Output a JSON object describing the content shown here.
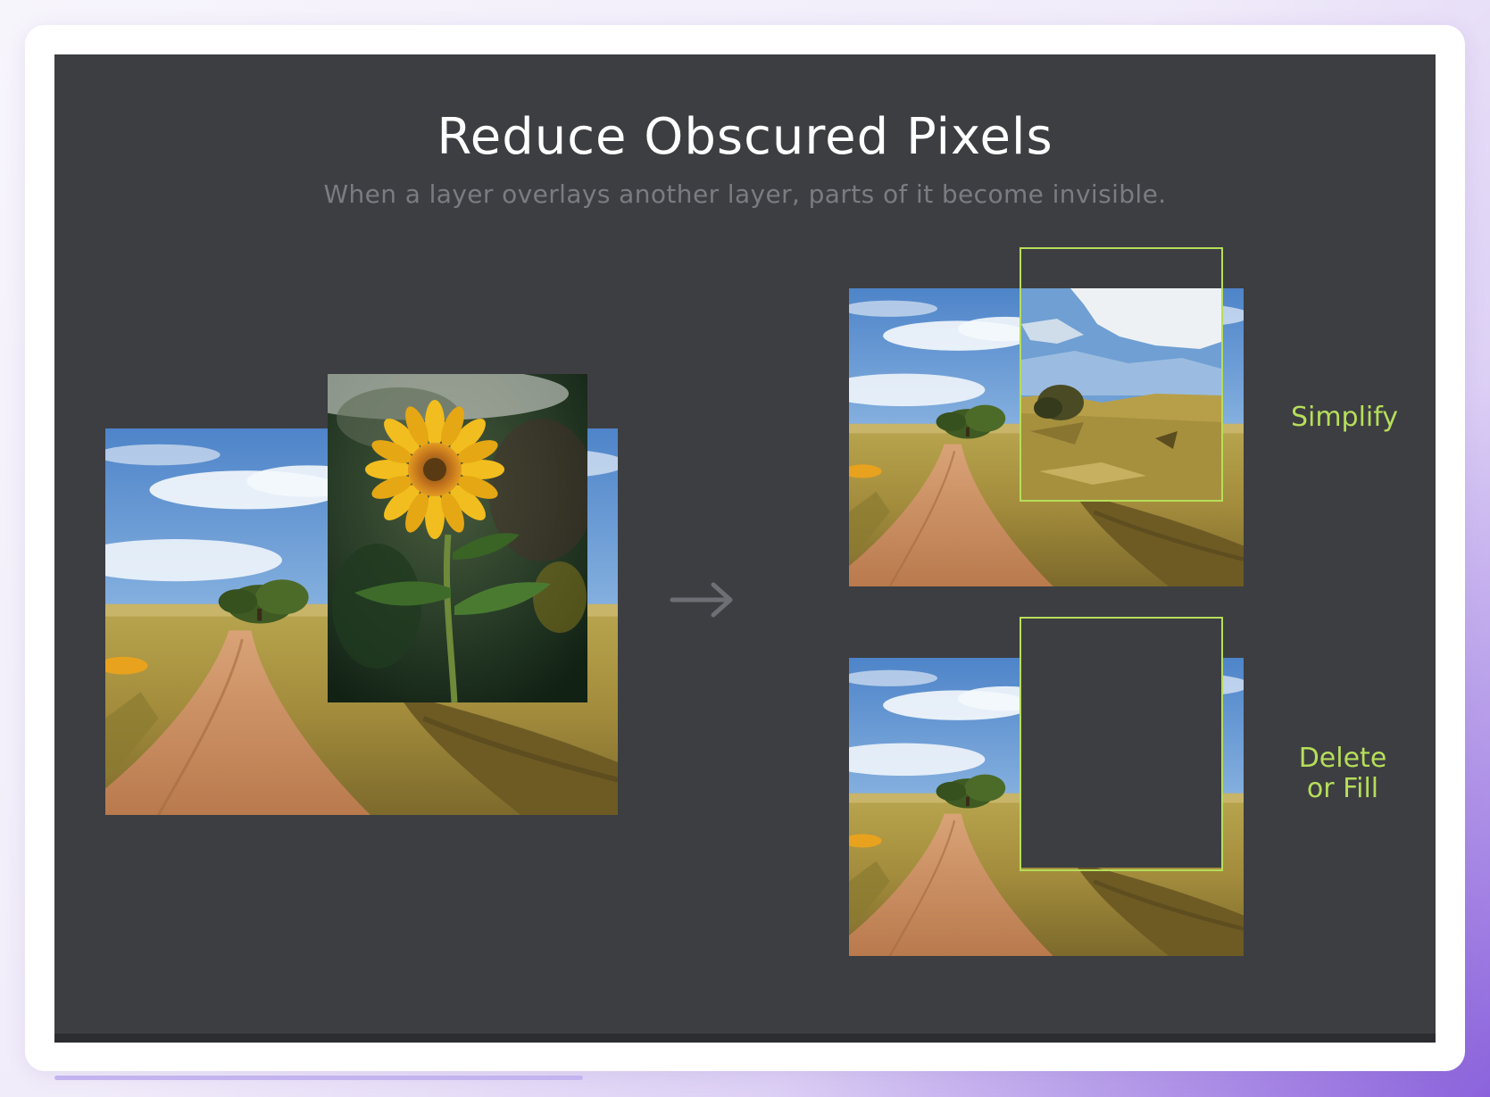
{
  "title": "Reduce Obscured Pixels",
  "subtitle": "When a layer overlays another layer, parts of it become invisible.",
  "labels": {
    "simplify": "Simplify",
    "delete_or_fill_line1": "Delete",
    "delete_or_fill_line2": "or Fill"
  },
  "colors": {
    "slide_background": "#3d3e42",
    "accent_green": "#b6de5a",
    "title": "#ffffff",
    "subtitle": "#7b7c82",
    "arrow": "#6e6f74"
  },
  "icons": {
    "arrow": "arrow-right-icon"
  }
}
